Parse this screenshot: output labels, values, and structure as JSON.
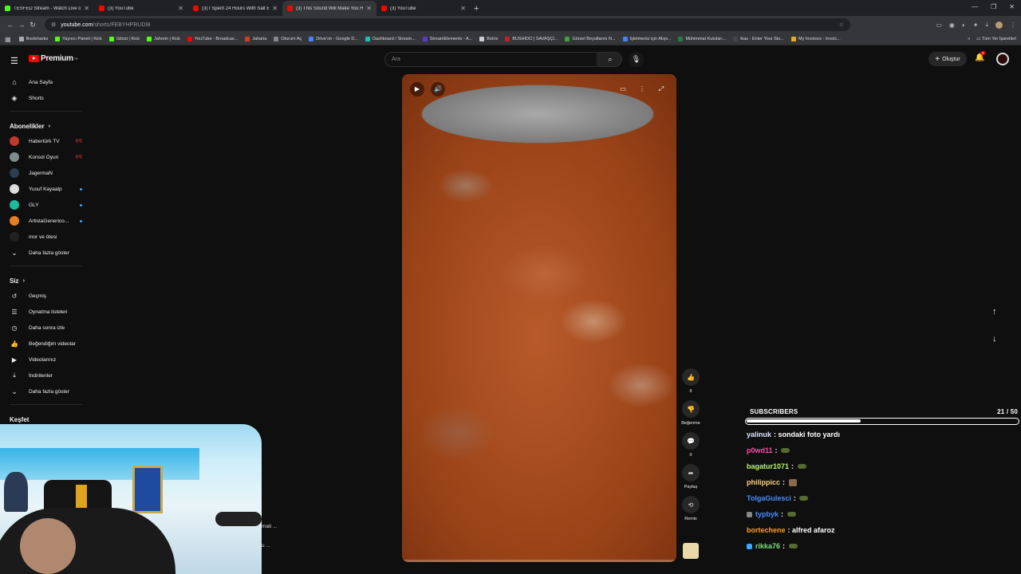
{
  "browser": {
    "tabs": [
      {
        "title": "TESFED Stream - Watch Live or",
        "color": "#53fc18",
        "active": false
      },
      {
        "title": "(3) YouTube",
        "color": "#ff0000",
        "active": false
      },
      {
        "title": "(3) I Spent 24 Hours With Salt B",
        "color": "#ff0000",
        "active": false
      },
      {
        "title": "(3) This Sound Will Make You H",
        "color": "#ff0000",
        "active": true
      },
      {
        "title": "(3) YouTube",
        "color": "#ff0000",
        "active": false
      }
    ],
    "new_tab": "+",
    "url_host": "youtube.com",
    "url_path": "/shorts/FEBYHPRUDI8",
    "bookmarks": [
      {
        "label": "Bookmarks",
        "color": "#aaaaaa"
      },
      {
        "label": "Yayıncı Paneli | Kick",
        "color": "#53fc18"
      },
      {
        "label": "Gitozt | Kick",
        "color": "#53fc18"
      },
      {
        "label": "Jahrein | Kick",
        "color": "#53fc18"
      },
      {
        "label": "YouTube - Broadcas...",
        "color": "#ff0000"
      },
      {
        "label": "Jaharia",
        "color": "#d04020"
      },
      {
        "label": "Oturum Aç",
        "color": "#888888"
      },
      {
        "label": "Drive'ım - Google D...",
        "color": "#4285f4"
      },
      {
        "label": "Dashboard / Stream...",
        "color": "#20c0b0"
      },
      {
        "label": "StreamElements - A...",
        "color": "#5b3cc4"
      },
      {
        "label": "Botrix",
        "color": "#cccccc"
      },
      {
        "label": "BUSHIDO | SAVAŞÇI...",
        "color": "#c0202a"
      },
      {
        "label": "Görsel Boyutlarını N...",
        "color": "#40a040"
      },
      {
        "label": "İşletmeniz için Alışv...",
        "color": "#4285f4"
      },
      {
        "label": "Mühimmat Kutuları...",
        "color": "#208040"
      },
      {
        "label": "ikas - Enter Your Sto...",
        "color": "#444444"
      },
      {
        "label": "My Invoices - Invoic...",
        "color": "#e0b020"
      }
    ],
    "bookmarks_more": "»",
    "all_bookmarks": "Tüm Yer İşaretleri"
  },
  "yt": {
    "brand": "Premium",
    "brand_sup": "TR",
    "search_placeholder": "Ara",
    "create_label": "Oluştur",
    "notif_count": "3",
    "nav": [
      {
        "label": "Ana Sayfa",
        "icon": "⌂"
      },
      {
        "label": "Shorts",
        "icon": "◈"
      }
    ],
    "subs_title": "Abonelikler",
    "subs": [
      {
        "label": "Habertürk TV",
        "color": "#c0392b",
        "status": "live"
      },
      {
        "label": "Konsol Oyun",
        "color": "#7f8c8d",
        "status": "live"
      },
      {
        "label": "JagermaN",
        "color": "#2c3e50",
        "status": ""
      },
      {
        "label": "Yusuf Kayaalp",
        "color": "#dddddd",
        "status": "dot"
      },
      {
        "label": "GLY",
        "color": "#1abc9c",
        "status": "dot"
      },
      {
        "label": "ArtistaGenerico...",
        "color": "#e67e22",
        "status": "dot"
      },
      {
        "label": "mor ve ötesi",
        "color": "#222222",
        "status": ""
      }
    ],
    "show_more": "Daha fazla göster",
    "you_title": "Siz",
    "you": [
      {
        "label": "Geçmiş",
        "icon": "↺"
      },
      {
        "label": "Oynatma listeleri",
        "icon": "☰"
      },
      {
        "label": "Daha sonra izle",
        "icon": "◷"
      },
      {
        "label": "Beğendiğim videolar",
        "icon": "👍"
      },
      {
        "label": "Videolarınız",
        "icon": "▶"
      },
      {
        "label": "İndirilenler",
        "icon": "⤓"
      }
    ],
    "show_more_2": "Daha fazla göster",
    "explore_title": "Keşfet",
    "behind_cam_1": "mati ...",
    "behind_cam_2": "u ...",
    "progress_fraction": 0,
    "actions": [
      {
        "icon": "👍",
        "label": "6"
      },
      {
        "icon": "👎",
        "label": "Beğenme"
      },
      {
        "icon": "💬",
        "label": "0"
      },
      {
        "icon": "➦",
        "label": "Paylaş"
      },
      {
        "icon": "⟲",
        "label": "Remix"
      }
    ]
  },
  "overlay": {
    "subs_label": "SUBSCRIBERS",
    "subs_count": "21 / 50",
    "subs_fraction": 0.42,
    "chat": [
      {
        "user": "yalinuk",
        "color": "#dbe4ff",
        "msg": "sondaki foto yardı",
        "emote": "",
        "badge": ""
      },
      {
        "user": "p0wd11",
        "color": "#ff4da6",
        "msg": "",
        "emote": "pepe",
        "badge": ""
      },
      {
        "user": "bagatur1071",
        "color": "#b8f56b",
        "msg": "",
        "emote": "pepe",
        "badge": ""
      },
      {
        "user": "philippicc",
        "color": "#ffd27a",
        "msg": "",
        "emote": "cat",
        "badge": ""
      },
      {
        "user": "TolgaGulesci",
        "color": "#4a8cff",
        "msg": "",
        "emote": "pepe",
        "badge": ""
      },
      {
        "user": "typbyk",
        "color": "#4a8cff",
        "msg": "",
        "emote": "pepe",
        "badge": "#888888"
      },
      {
        "user": "bortechene",
        "color": "#ff9f1c",
        "msg": "alfred afaroz",
        "emote": "",
        "badge": ""
      },
      {
        "user": "rikka76",
        "color": "#7ee07e",
        "msg": "",
        "emote": "pepe",
        "badge": "#3ea6ff"
      }
    ]
  }
}
